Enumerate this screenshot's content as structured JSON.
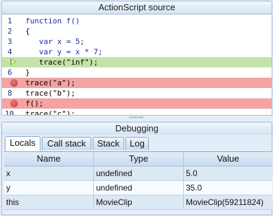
{
  "source_panel": {
    "title": "ActionScript source",
    "lines": [
      {
        "num": "1",
        "text": "function f()",
        "style": "kw"
      },
      {
        "num": "2",
        "text": "{",
        "style": "plain"
      },
      {
        "num": "3",
        "text": "   var x = 5;",
        "style": "kw"
      },
      {
        "num": "4",
        "text": "   var y = x * 7;",
        "style": "kw"
      },
      {
        "num": "",
        "text": "   trace(\"inf\");",
        "style": "current"
      },
      {
        "num": "6",
        "text": "}",
        "style": "plain"
      },
      {
        "num": "",
        "text": "trace(\"a\");",
        "style": "breakpoint"
      },
      {
        "num": "8",
        "text": "trace(\"b\");",
        "style": "plain"
      },
      {
        "num": "",
        "text": "f();",
        "style": "breakpoint"
      },
      {
        "num": "10",
        "text": "trace(\"c\");",
        "style": "plain"
      }
    ]
  },
  "splitter": {
    "grip": "••••••"
  },
  "debug_panel": {
    "title": "Debugging",
    "tabs": {
      "locals": "Locals",
      "callstack": "Call stack",
      "stack": "Stack",
      "log": "Log"
    },
    "active_tab": "Locals",
    "columns": {
      "name": "Name",
      "type": "Type",
      "value": "Value"
    },
    "rows": [
      {
        "name": "x",
        "type": "undefined",
        "value": "5.0"
      },
      {
        "name": "y",
        "type": "undefined",
        "value": "35.0"
      },
      {
        "name": "this",
        "type": "MovieClip",
        "value": "MovieClip(59211824)"
      }
    ]
  },
  "colors": {
    "current_line": "#c5e3a8",
    "breakpoint_line": "#f4a3a3",
    "keyword": "#1a2fa3",
    "panel_bg": "#e3edf7"
  },
  "icons": {
    "current_line_marker": "arrow-right-icon",
    "breakpoint_marker": "breakpoint-dot-icon"
  }
}
